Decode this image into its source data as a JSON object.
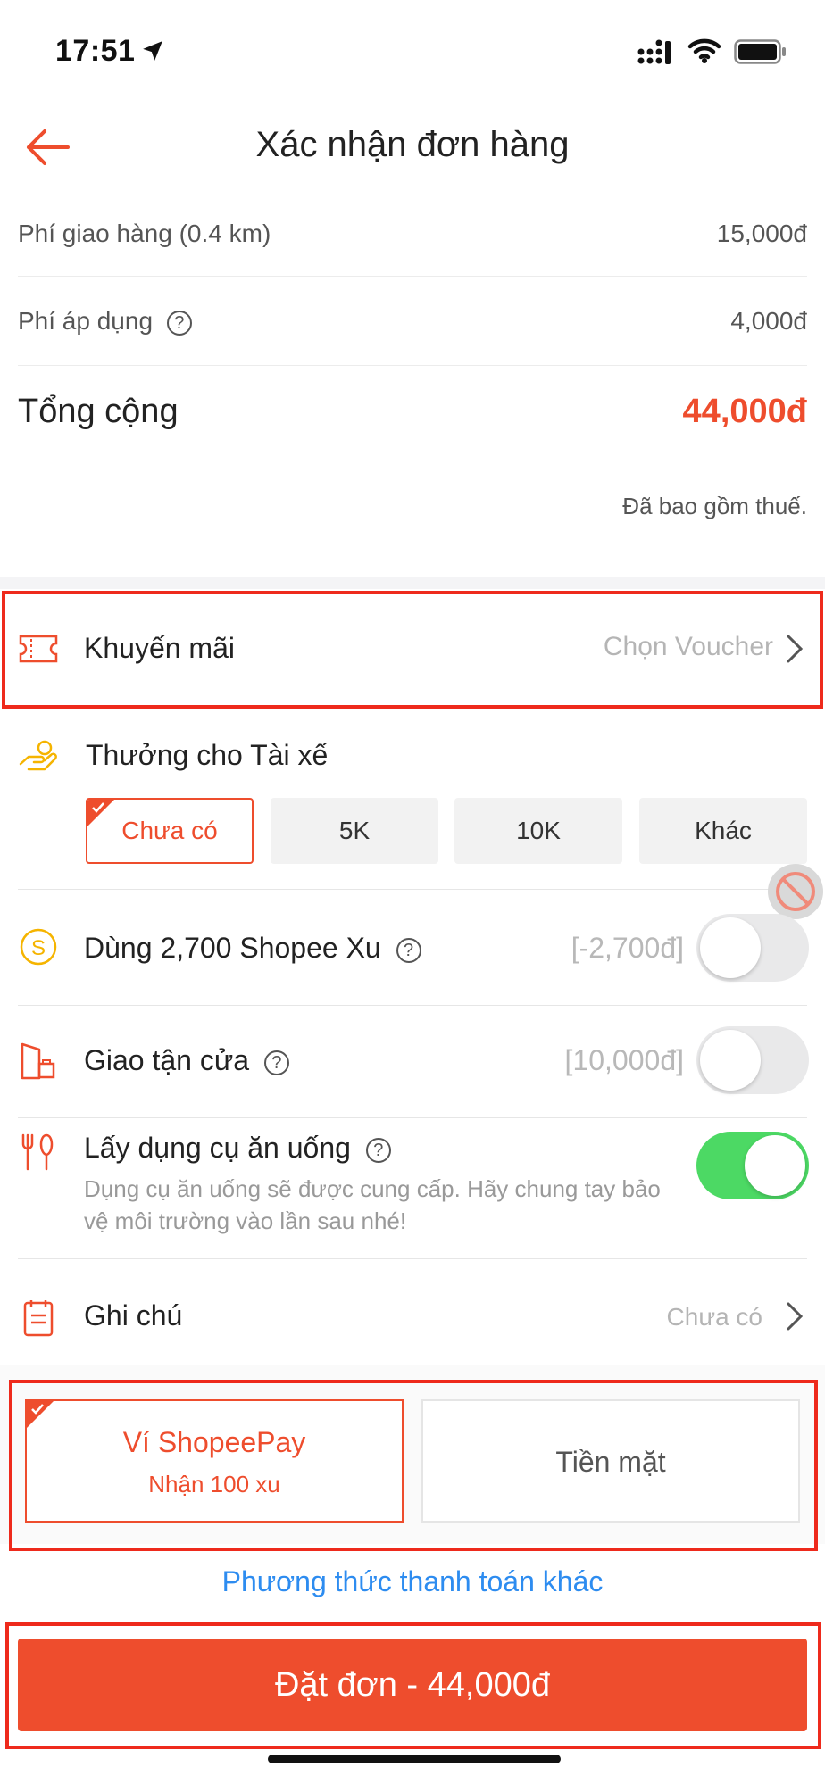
{
  "status_bar": {
    "time": "17:51"
  },
  "header": {
    "title": "Xác nhận đơn hàng"
  },
  "fees": {
    "delivery_label": "Phí giao hàng (0.4 km)",
    "delivery_value": "15,000đ",
    "service_label": "Phí áp dụng",
    "service_value": "4,000đ",
    "help_glyph": "?"
  },
  "total": {
    "label": "Tổng cộng",
    "value": "44,000đ",
    "tax_note": "Đã bao gồm thuế."
  },
  "promo": {
    "label": "Khuyến mãi",
    "action": "Chọn Voucher"
  },
  "tip": {
    "label": "Thưởng cho Tài xế",
    "options": [
      "Chưa có",
      "5K",
      "10K",
      "Khác"
    ],
    "selected": "Chưa có"
  },
  "coins": {
    "label": "Dùng 2,700 Shopee Xu",
    "value": "[-2,700đ]",
    "enabled": false
  },
  "door": {
    "label": "Giao tận cửa",
    "value": "[10,000đ]",
    "enabled": false
  },
  "utensils": {
    "label": "Lấy dụng cụ ăn uống",
    "description": "Dụng cụ ăn uống sẽ được cung cấp. Hãy chung tay bảo vệ môi trường vào lần sau nhé!",
    "enabled": true
  },
  "note": {
    "label": "Ghi chú",
    "value": "Chưa có"
  },
  "payment": {
    "options": [
      {
        "title": "Ví ShopeePay",
        "subtitle": "Nhận 100 xu",
        "selected": true
      },
      {
        "title": "Tiền mặt",
        "subtitle": "",
        "selected": false
      }
    ],
    "other_link": "Phương thức thanh toán khác"
  },
  "order_button": {
    "label": "Đặt đơn - 44,000đ"
  },
  "colors": {
    "brand": "#ee4d2d",
    "highlight_frame": "#ee2a1c",
    "toggle_on": "#4cd964",
    "link": "#2d8cf0",
    "tip_icon": "#f5b400",
    "coin_icon": "#f5b400"
  }
}
